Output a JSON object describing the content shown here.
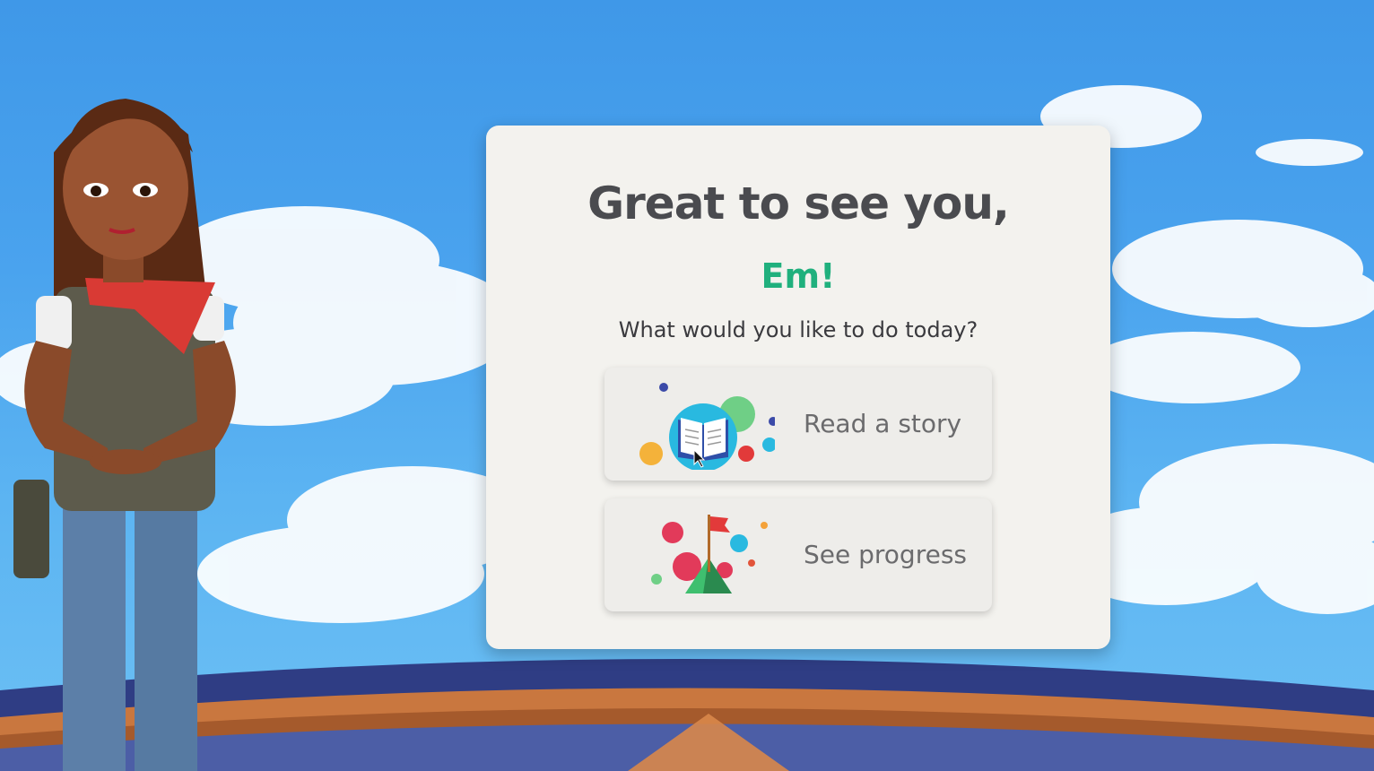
{
  "welcome": {
    "greeting": "Great to see you,",
    "name": "Em!",
    "question": "What would you like to do today?"
  },
  "options": [
    {
      "label": "Read a story",
      "icon": "open-book-icon"
    },
    {
      "label": "See progress",
      "icon": "flag-on-mountain-icon"
    }
  ],
  "colors": {
    "sky": "#4aa3ee",
    "card": "#f3f2ee",
    "name_accent": "#20b07d",
    "greeting_text": "#4a4b4f",
    "option_label": "#6b6b6d"
  }
}
